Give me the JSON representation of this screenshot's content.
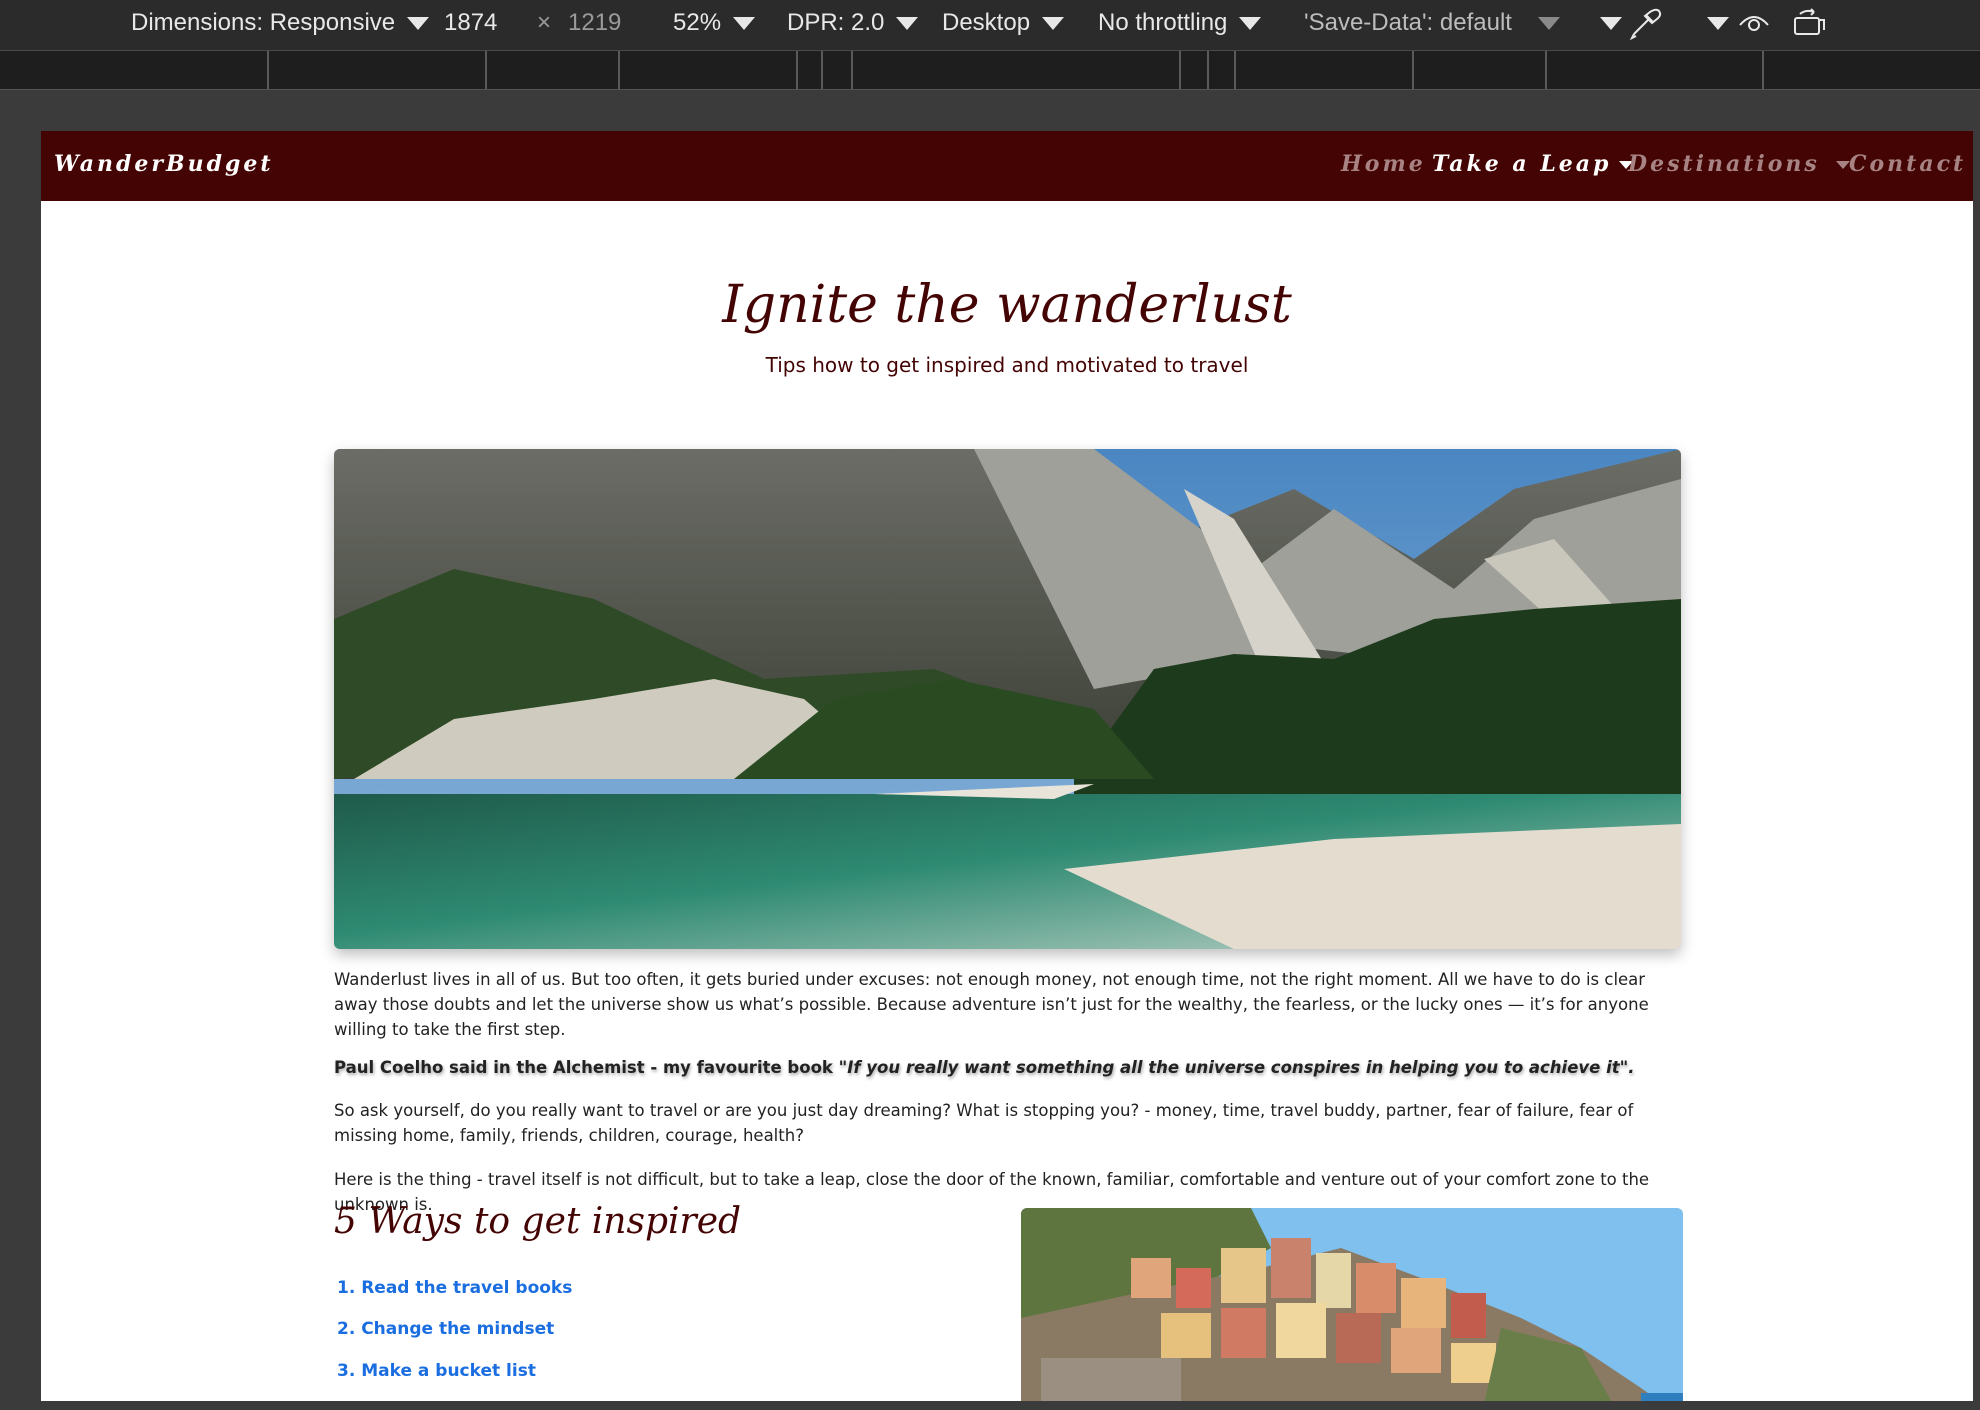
{
  "devtools": {
    "dimensions_label": "Dimensions: Responsive",
    "width_value": "1874",
    "times": "×",
    "height_value": "1219",
    "zoom": "52%",
    "dpr": "DPR: 2.0",
    "device": "Desktop",
    "throttling": "No throttling",
    "save_data": "'Save-Data': default"
  },
  "nav": {
    "brand": "WanderBudget",
    "links": [
      "Home",
      "Take a Leap",
      "Destinations",
      "Contact"
    ],
    "active_color": "#ffffff",
    "inactive_color": "#a78383",
    "bg_color": "#450404"
  },
  "hero": {
    "title": "Ignite the wanderlust",
    "subtitle": "Tips how to get inspired and motivated to travel"
  },
  "article": {
    "p1": "Wanderlust lives in all of us. But too often, it gets buried under excuses: not enough money, not enough time, not the right moment. All we have to do is clear away those doubts and let the universe show us what’s possible. Because adventure isn’t just for the wealthy, the fearless, or the lucky ones — it’s for anyone willing to take the first step.",
    "quote_lead": "Paul Coelho said in the Alchemist - my favourite book ",
    "quote_text": "\"If you really want something all the universe conspires in helping you to achieve it\".",
    "p2": "So ask yourself, do you really want to travel or are you just day dreaming? What is stopping you? - money, time, travel buddy, partner, fear of failure, fear of missing home, family, friends, children, courage, health?",
    "p3": "Here is the thing - travel itself is not difficult, but to take a leap, close the door of the known, familiar, comfortable and venture out of your comfort zone to the unknown is."
  },
  "ways": {
    "title": "5 Ways to get inspired",
    "items": [
      "1. Read the travel books",
      "2. Change the mindset",
      "3. Make a bucket list"
    ],
    "link_color": "#1a6ee0"
  }
}
